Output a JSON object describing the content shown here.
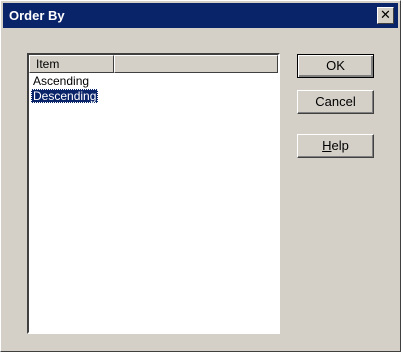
{
  "window": {
    "title": "Order By",
    "close_glyph": "✕"
  },
  "list": {
    "columns": [
      "Item",
      ""
    ],
    "items": [
      "Ascending",
      "Descending"
    ],
    "selected_index": 1
  },
  "buttons": {
    "ok": "OK",
    "cancel": "Cancel",
    "help_accel": "H",
    "help_rest": "elp"
  },
  "colors": {
    "titlebar": "#0a246a",
    "dialog_bg": "#d4d0c8",
    "selection": "#0a246a"
  }
}
